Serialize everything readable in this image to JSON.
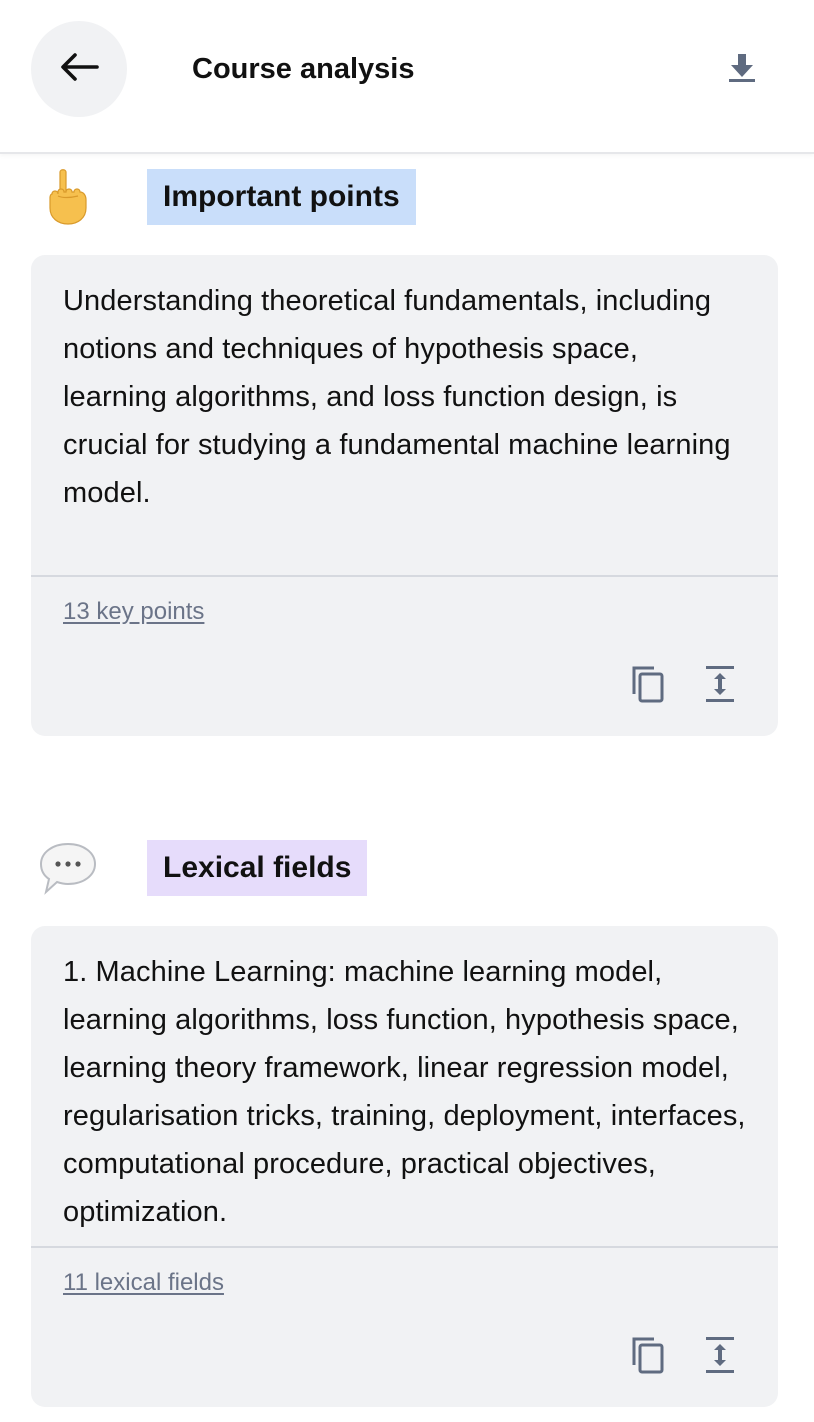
{
  "header": {
    "title": "Course analysis",
    "back_icon": "arrow-left-icon",
    "download_icon": "download-icon"
  },
  "sections": [
    {
      "emoji": "pointing-up-emoji",
      "label": "Important points",
      "label_color": "#c9defa",
      "body": "Understanding theoretical fundamentals, including notions and techniques of hypothesis space, learning algorithms, and loss function design, is crucial for studying a fundamental machine learning model.",
      "link": "13 key points",
      "actions": [
        "copy-icon",
        "expand-icon"
      ]
    },
    {
      "emoji": "speech-bubble-emoji",
      "label": "Lexical fields",
      "label_color": "#e6dcfb",
      "body": "1. Machine Learning: machine learning model, learning algorithms, loss function, hypothesis space, learning theory framework, linear regression model, regularisation tricks, training, deployment, interfaces, computational procedure, practical objectives, optimization.",
      "link": "11 lexical fields",
      "actions": [
        "copy-icon",
        "expand-icon"
      ]
    }
  ],
  "colors": {
    "card_bg": "#f1f2f4",
    "icon_gray": "#6b7488",
    "link_gray": "#6b7488"
  }
}
